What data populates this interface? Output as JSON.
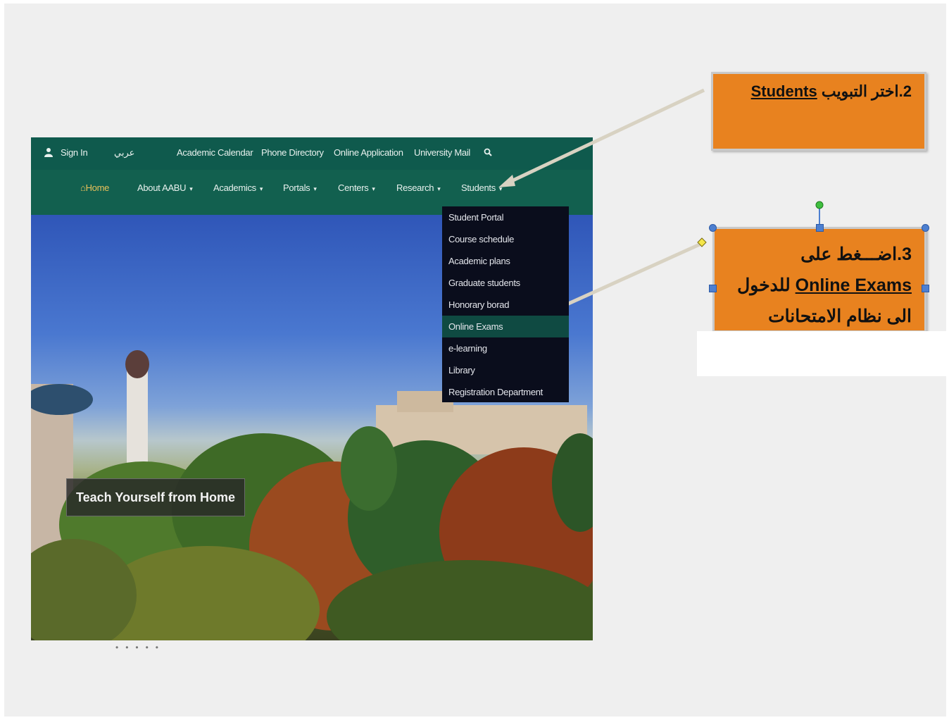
{
  "topbar": {
    "sign_in": "Sign  In",
    "arabic": "عربي",
    "links": [
      "Academic Calendar",
      "Phone Directory",
      "Online Application",
      "University Mail"
    ]
  },
  "nav": {
    "home": "Home",
    "items": [
      "About AABU",
      "Academics",
      "Portals",
      "Centers",
      "Research",
      "Students"
    ]
  },
  "dropdown": {
    "items": [
      "Student Portal",
      "Course schedule",
      "Academic plans",
      "Graduate students",
      "Honorary borad",
      "Online Exams",
      "e-learning",
      "Library",
      "Registration Department"
    ],
    "active": "Online Exams"
  },
  "hero": {
    "caption": "Teach Yourself from Home"
  },
  "callouts": {
    "step2_prefix": "2.اختر التبويب ",
    "step2_link": "Students",
    "step3_line1": "3.اضـــغط على",
    "step3_link": "Online Exams",
    "step3_suffix": " للدخول",
    "step3_line3": "الى نظام الامتحانات"
  },
  "colors": {
    "site_green": "#0f5a4d",
    "callout_orange": "#e8821f",
    "dropdown_bg": "#0a0d1c",
    "active_item": "#0f4a42"
  }
}
